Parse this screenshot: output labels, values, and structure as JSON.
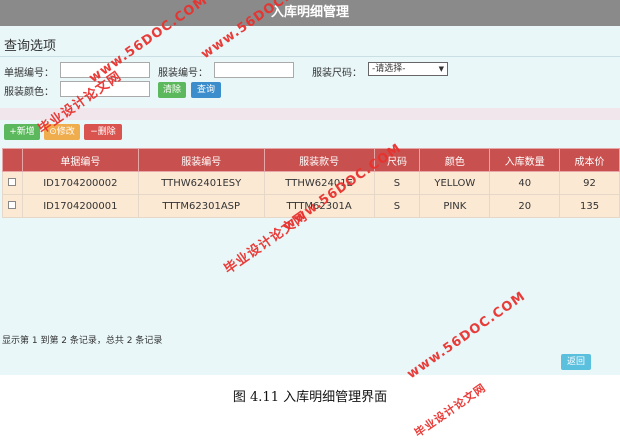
{
  "window": {
    "title": "入库明细管理"
  },
  "query": {
    "title": "查询选项",
    "order_no_label": "单据编号：",
    "garment_no_label": "服装编号：",
    "size_label": "服装尺码：",
    "size_value": "-请选择-",
    "color_label": "服装颜色：",
    "clear_label": "清除",
    "search_label": "查询"
  },
  "toolbar": {
    "add_label": "+新增",
    "edit_label": "修改",
    "delete_label": "删除"
  },
  "table": {
    "headers": [
      "单据编号",
      "服装编号",
      "服装款号",
      "尺码",
      "颜色",
      "入库数量",
      "成本价"
    ],
    "rows": [
      [
        "ID1704200002",
        "TTHW62401ESY",
        "TTHW62401E",
        "S",
        "YELLOW",
        "40",
        "92"
      ],
      [
        "ID1704200001",
        "TTTM62301ASP",
        "TTTM62301A",
        "S",
        "PINK",
        "20",
        "135"
      ]
    ]
  },
  "footer": {
    "pagination": "显示第 1 到第 2 条记录，总共 2 条记录"
  },
  "actions": {
    "back_label": "返回"
  },
  "caption": "图 4.11 入库明细管理界面",
  "watermarks": [
    "毕业设计论文网",
    "www.56DOC.COM"
  ],
  "colors": {
    "header_red": "#c8514f",
    "btn_green": "#5cb85c",
    "btn_blue": "#3c8dcc",
    "btn_orange": "#f0ad4e",
    "btn_red": "#d9534f",
    "btn_cyan": "#5bc0de",
    "watermark_red": "#e8322f"
  }
}
